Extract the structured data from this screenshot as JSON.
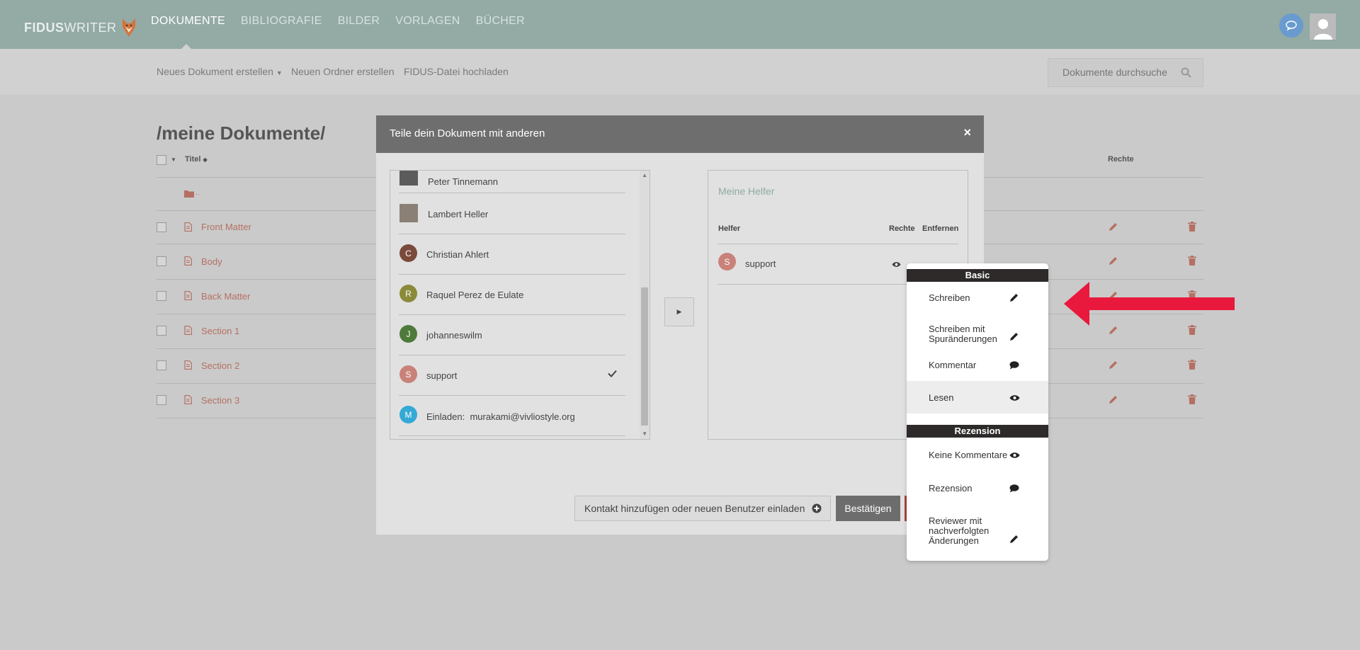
{
  "header": {
    "logo_bold": "FIDUS",
    "logo_light": "WRITER",
    "nav": [
      "DOKUMENTE",
      "BIBLIOGRAFIE",
      "BILDER",
      "VORLAGEN",
      "BÜCHER"
    ]
  },
  "toolbar": {
    "new_document": "Neues Dokument erstellen",
    "new_folder": "Neuen Ordner erstellen",
    "upload": "FIDUS-Datei hochladen",
    "search_placeholder": "Dokumente durchsuche"
  },
  "page": {
    "title": "/meine Dokumente/",
    "col_title": "Titel",
    "col_rights": "Rechte",
    "parent_folder": "..",
    "documents": [
      "Front Matter",
      "Body",
      "Back Matter",
      "Section 1",
      "Section 2",
      "Section 3"
    ]
  },
  "modal": {
    "title": "Teile dein Dokument mit anderen",
    "close": "×",
    "contacts": [
      {
        "name": "Peter Tinnemann",
        "initial": "",
        "color": "#777777"
      },
      {
        "name": "Lambert Heller",
        "initial": "",
        "color": "#666666"
      },
      {
        "name": "Christian Ahlert",
        "initial": "C",
        "color": "#7a4b3c"
      },
      {
        "name": "Raquel Perez de Eulate",
        "initial": "R",
        "color": "#8a8a3a"
      },
      {
        "name": "johanneswilm",
        "initial": "J",
        "color": "#4e7a3a"
      },
      {
        "name": "support",
        "initial": "S",
        "color": "#c9827a"
      },
      {
        "name": "murakami@vivliostyle.org",
        "initial": "M",
        "color": "#35a9d6",
        "prefix": "Einladen:"
      }
    ],
    "helpers_title": "Meine Helfer",
    "col_helper": "Helfer",
    "col_rights": "Rechte",
    "col_remove": "Entfernen",
    "helper": {
      "name": "support",
      "initial": "S",
      "color": "#c9827a"
    },
    "add_contact": "Kontakt hinzufügen oder neuen Benutzer einladen",
    "confirm": "Bestätigen"
  },
  "dropdown": {
    "section_basic": "Basic",
    "section_review": "Rezension",
    "basic_items": [
      {
        "label": "Schreiben",
        "icon": "pencil-icon"
      },
      {
        "label": "Schreiben mit Spuränderungen",
        "icon": "pencil-icon"
      },
      {
        "label": "Kommentar",
        "icon": "comment-icon"
      },
      {
        "label": "Lesen",
        "icon": "eye-icon",
        "selected": true
      }
    ],
    "review_items": [
      {
        "label": "Keine Kommentare",
        "icon": "eye-icon"
      },
      {
        "label": "Rezension",
        "icon": "comment-icon"
      },
      {
        "label": "Reviewer mit nachverfolgten Änderungen",
        "icon": "pencil-icon"
      }
    ]
  },
  "colors": {
    "header": "#93aaa5",
    "link": "#b57063",
    "annotation_arrow": "#e8193c",
    "modal_header": "#6e6e6e"
  }
}
